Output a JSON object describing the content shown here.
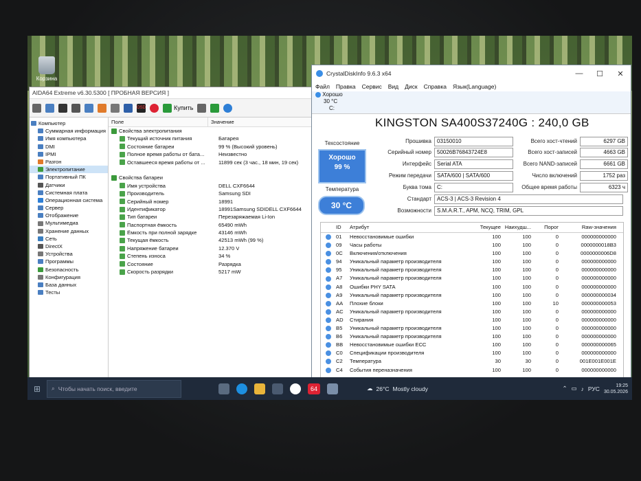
{
  "desktop": {
    "recycle_label": "Корзина"
  },
  "aida": {
    "title": "AIDA64 Extreme v6.30.5300  [ ПРОБНАЯ ВЕРСИЯ ]",
    "buy_label": "Купить",
    "col_field": "Поле",
    "col_value": "Значение",
    "tree": [
      {
        "label": "Компьютер",
        "color": "#4a7fc1"
      },
      {
        "label": "Суммарная информация",
        "color": "#4a7fc1"
      },
      {
        "label": "Имя компьютера",
        "color": "#4a7fc1"
      },
      {
        "label": "DMI",
        "color": "#4a7fc1"
      },
      {
        "label": "IPMI",
        "color": "#4a7fc1"
      },
      {
        "label": "Разгон",
        "color": "#e07a2a"
      },
      {
        "label": "Электропитание",
        "color": "#3c9a3c"
      },
      {
        "label": "Портативный ПК",
        "color": "#4a7fc1"
      },
      {
        "label": "Датчики",
        "color": "#555555"
      },
      {
        "label": "Системная плата",
        "color": "#4a7fc1"
      },
      {
        "label": "Операционная система",
        "color": "#2e7fd6"
      },
      {
        "label": "Сервер",
        "color": "#4a7fc1"
      },
      {
        "label": "Отображение",
        "color": "#4a7fc1"
      },
      {
        "label": "Мультимедиа",
        "color": "#777777"
      },
      {
        "label": "Хранение данных",
        "color": "#777777"
      },
      {
        "label": "Сеть",
        "color": "#3a7fc1"
      },
      {
        "label": "DirectX",
        "color": "#555555"
      },
      {
        "label": "Устройства",
        "color": "#777777"
      },
      {
        "label": "Программы",
        "color": "#4a7fc1"
      },
      {
        "label": "Безопасность",
        "color": "#3c9a3c"
      },
      {
        "label": "Конфигурация",
        "color": "#777777"
      },
      {
        "label": "База данных",
        "color": "#4a7fc1"
      },
      {
        "label": "Тесты",
        "color": "#4a7fc1"
      }
    ],
    "rows": [
      {
        "field": "Свойства электропитания",
        "value": "",
        "section": true
      },
      {
        "field": "Текущий источник питания",
        "value": "Батарея"
      },
      {
        "field": "Состояние батареи",
        "value": "99 % (Высокий уровень)"
      },
      {
        "field": "Полное время работы от бата...",
        "value": "Неизвестно"
      },
      {
        "field": "Оставшееся время работы от ...",
        "value": "11899 сек (3 час., 18 мин, 19 сек)"
      },
      {
        "field": "",
        "value": "",
        "blank": true
      },
      {
        "field": "Свойства батареи",
        "value": "",
        "section": true
      },
      {
        "field": "Имя устройства",
        "value": "DELL CXF6644"
      },
      {
        "field": "Производитель",
        "value": "Samsung SDI"
      },
      {
        "field": "Серийный номер",
        "value": "18991"
      },
      {
        "field": "Идентификатор",
        "value": "18991Samsung SDIDELL CXF6644"
      },
      {
        "field": "Тип батареи",
        "value": "Перезаряжаемая Li-Ion"
      },
      {
        "field": "Паспортная ёмкость",
        "value": "65490 mWh"
      },
      {
        "field": "Ёмкость при полной зарядке",
        "value": "43146 mWh"
      },
      {
        "field": "Текущая ёмкость",
        "value": "42513 mWh  (99 %)"
      },
      {
        "field": "Напряжение батареи",
        "value": "12.370 V"
      },
      {
        "field": "Степень износа",
        "value": "34 %"
      },
      {
        "field": "Состояние",
        "value": "Разрядка"
      },
      {
        "field": "Скорость разрядки",
        "value": "5217 mW"
      }
    ]
  },
  "cdi": {
    "title": "CrystalDiskInfo 9.6.3 x64",
    "menu": [
      "Файл",
      "Правка",
      "Сервис",
      "Вид",
      "Диск",
      "Справка",
      "Язык(Language)"
    ],
    "drive_status": "Хорошо",
    "drive_temp": "30 °C",
    "drive_letter": "C:",
    "model": "KINGSTON SA400S37240G : 240,0 GB",
    "health_label": "Техсостояние",
    "health_status": "Хорошо",
    "health_percent": "99 %",
    "temp_label": "Температура",
    "temp_value": "30 °C",
    "info": {
      "firmware_label": "Прошивка",
      "firmware": "03150010",
      "serial_label": "Серийный номер",
      "serial": "50026B76843724E8",
      "interface_label": "Интерфейс",
      "interface": "Serial ATA",
      "transfer_label": "Режим передачи",
      "transfer": "SATA/600 | SATA/600",
      "letter_label": "Буква тома",
      "letter": "C:",
      "standard_label": "Стандарт",
      "standard": "ACS-3 | ACS-3 Revision 4",
      "features_label": "Возможности",
      "features": "S.M.A.R.T., APM, NCQ, TRIM, GPL",
      "host_reads_label": "Всего хост-чтений",
      "host_reads": "6297 GB",
      "host_writes_label": "Всего хост-записей",
      "host_writes": "4663 GB",
      "nand_writes_label": "Всего NAND-записей",
      "nand_writes": "6661 GB",
      "power_count_label": "Число включений",
      "power_count": "1752 раз",
      "power_hours_label": "Общее время работы",
      "power_hours": "6323 ч"
    },
    "smart_headers": [
      "ID",
      "Атрибут",
      "Текущее",
      "Наихудш...",
      "Порог",
      "Raw-значения"
    ],
    "smart": [
      {
        "id": "01",
        "name": "Невосстановимые ошибки",
        "cur": "100",
        "worst": "100",
        "thr": "0",
        "raw": "000000000000"
      },
      {
        "id": "09",
        "name": "Часы работы",
        "cur": "100",
        "worst": "100",
        "thr": "0",
        "raw": "0000000018B3"
      },
      {
        "id": "0C",
        "name": "Включения/отключения",
        "cur": "100",
        "worst": "100",
        "thr": "0",
        "raw": "0000000006D8"
      },
      {
        "id": "94",
        "name": "Уникальный параметр производителя",
        "cur": "100",
        "worst": "100",
        "thr": "0",
        "raw": "000000000000"
      },
      {
        "id": "95",
        "name": "Уникальный параметр производителя",
        "cur": "100",
        "worst": "100",
        "thr": "0",
        "raw": "000000000000"
      },
      {
        "id": "A7",
        "name": "Уникальный параметр производителя",
        "cur": "100",
        "worst": "100",
        "thr": "0",
        "raw": "000000000000"
      },
      {
        "id": "A8",
        "name": "Ошибки PHY SATA",
        "cur": "100",
        "worst": "100",
        "thr": "0",
        "raw": "000000000000"
      },
      {
        "id": "A9",
        "name": "Уникальный параметр производителя",
        "cur": "100",
        "worst": "100",
        "thr": "0",
        "raw": "000000000034"
      },
      {
        "id": "AA",
        "name": "Плохие блоки",
        "cur": "100",
        "worst": "100",
        "thr": "10",
        "raw": "000000000053"
      },
      {
        "id": "AC",
        "name": "Уникальный параметр производителя",
        "cur": "100",
        "worst": "100",
        "thr": "0",
        "raw": "000000000000"
      },
      {
        "id": "AD",
        "name": "Стирания",
        "cur": "100",
        "worst": "100",
        "thr": "0",
        "raw": "000000000000"
      },
      {
        "id": "B5",
        "name": "Уникальный параметр производителя",
        "cur": "100",
        "worst": "100",
        "thr": "0",
        "raw": "000000000000"
      },
      {
        "id": "B6",
        "name": "Уникальный параметр производителя",
        "cur": "100",
        "worst": "100",
        "thr": "0",
        "raw": "000000000000"
      },
      {
        "id": "BB",
        "name": "Невосстановимые ошибки ECC",
        "cur": "100",
        "worst": "100",
        "thr": "0",
        "raw": "000000000065"
      },
      {
        "id": "C0",
        "name": "Спецификации производителя",
        "cur": "100",
        "worst": "100",
        "thr": "0",
        "raw": "000000000000"
      },
      {
        "id": "C2",
        "name": "Температура",
        "cur": "30",
        "worst": "30",
        "thr": "0",
        "raw": "001E001E001E"
      },
      {
        "id": "C4",
        "name": "События переназначения",
        "cur": "100",
        "worst": "100",
        "thr": "0",
        "raw": "000000000000"
      }
    ]
  },
  "taskbar": {
    "search_placeholder": "Чтобы начать поиск, введите",
    "weather_temp": "26°C",
    "weather_desc": "Mostly cloudy",
    "lang": "РУС",
    "time": "19:25",
    "date": "30.05.2026",
    "app_badge": "64"
  }
}
